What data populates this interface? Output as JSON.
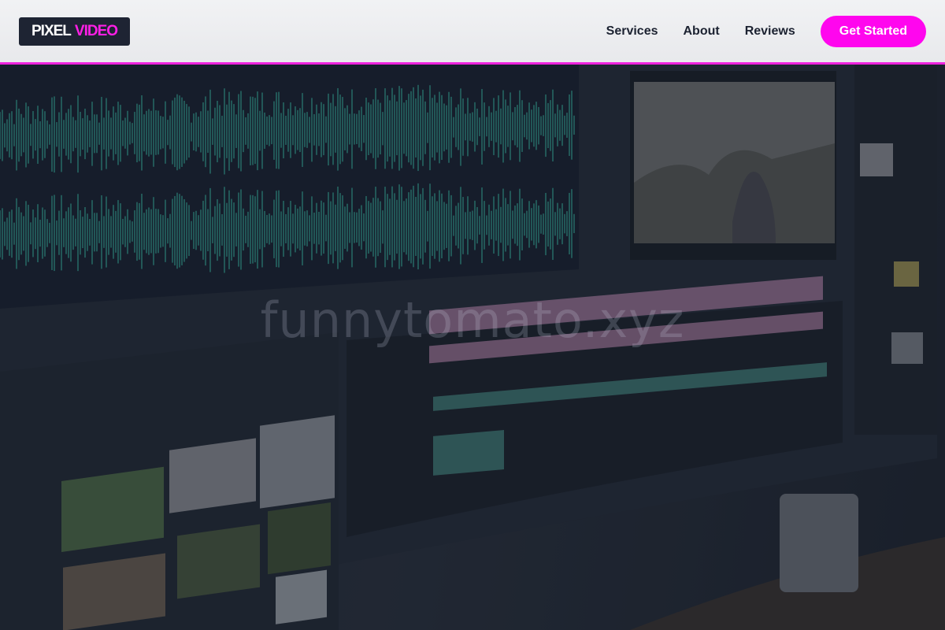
{
  "brand": {
    "word1": "PIXEL",
    "word2": "VIDEO",
    "accent_color": "#ff06ee",
    "dark_color": "#1e2433"
  },
  "nav": {
    "items": [
      {
        "label": "Services"
      },
      {
        "label": "About"
      },
      {
        "label": "Reviews"
      }
    ],
    "cta_label": "Get Started"
  },
  "hero": {
    "image": "video-editing-monitor",
    "watermark": "funnytomato.xyz"
  }
}
